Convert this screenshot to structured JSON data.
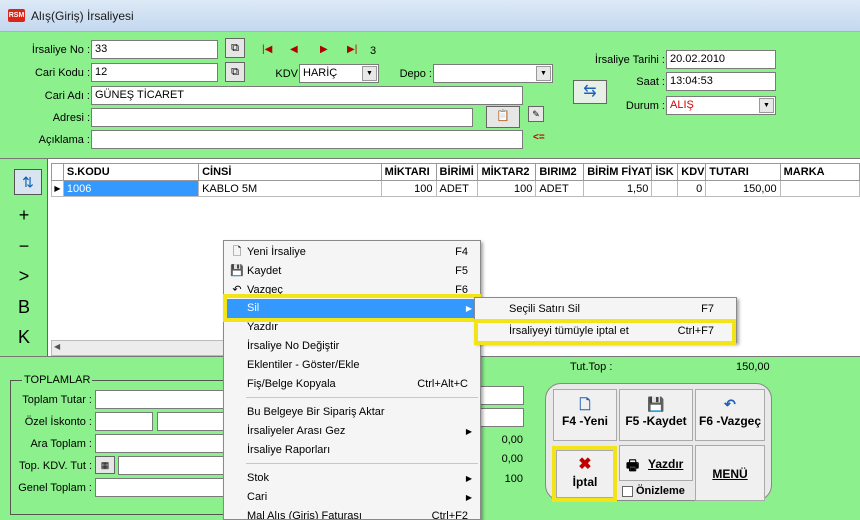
{
  "window": {
    "title": "Alış(Giriş) İrsaliyesi",
    "app_icon": "RSM"
  },
  "header": {
    "irsaliye_no_label": "İrsaliye No :",
    "irsaliye_no_value": "33",
    "cari_kodu_label": "Cari Kodu :",
    "cari_kodu_value": "12",
    "cari_adi_label": "Cari Adı :",
    "cari_adi_value": "GÜNEŞ TİCARET",
    "adresi_label": "Adresi :",
    "adresi_value": "",
    "aciklama_label": "Açıklama :",
    "aciklama_value": "",
    "kdv_label": "KDV",
    "kdv_value": "HARİÇ",
    "depo_label": "Depo :",
    "depo_value": "",
    "record_count": "3",
    "tarih_label": "İrsaliye Tarihi :",
    "tarih_value": "20.02.2010",
    "saat_label": "Saat :",
    "saat_value": "13:04:53",
    "durum_label": "Durum :",
    "durum_value": "ALIŞ",
    "back_arrow": "<="
  },
  "grid": {
    "toolbar": {
      "add": "+",
      "remove": "−",
      "next": ">",
      "b": "B",
      "k": "K"
    },
    "columns": [
      "S.KODU",
      "CİNSİ",
      "MİKTARI",
      "BİRİMİ",
      "MİKTAR2",
      "BIRIM2",
      "BİRİM FİYAT",
      "İSK",
      "KDV",
      "TUTARI",
      "MARKA"
    ],
    "rows": [
      [
        "1006",
        "KABLO 5M",
        "100",
        "ADET",
        "100",
        "ADET",
        "1,50",
        "",
        "0",
        "150,00",
        ""
      ]
    ]
  },
  "totals": {
    "group_title": "TOPLAMLAR",
    "toplam_tutar_label": "Toplam Tutar :",
    "ozel_iskonto_label": "Özel İskonto :",
    "ara_toplam_label": "Ara Toplam :",
    "top_kdv_label": "Top. KDV. Tut :",
    "genel_toplam_label": "Genel Toplam :",
    "tut_top_label": "Tut.Top :",
    "tut_top_value": "150,00",
    "val_1": "0,00",
    "val_2": "0,00",
    "val_3": "100"
  },
  "buttons": {
    "yeni": "F4 -Yeni",
    "kaydet": "F5 -Kaydet",
    "vazgec": "F6 -Vazgeç",
    "iptal": "İptal",
    "yazdir": "Yazdır",
    "menu": "MENÜ",
    "onizleme": "Önizleme"
  },
  "context_menu": {
    "items": [
      {
        "label": "Yeni İrsaliye",
        "shortcut": "F4",
        "icon": "new-doc-icon"
      },
      {
        "label": "Kaydet",
        "shortcut": "F5",
        "icon": "save-icon"
      },
      {
        "label": "Vazgeç",
        "shortcut": "F6",
        "icon": "undo-icon"
      },
      {
        "label": "Sil",
        "shortcut": "",
        "icon": ""
      },
      {
        "label": "Yazdır",
        "shortcut": "",
        "icon": ""
      },
      {
        "label": "İrsaliye No Değiştir",
        "shortcut": "",
        "icon": ""
      },
      {
        "label": "Eklentiler - Göster/Ekle",
        "shortcut": "",
        "icon": ""
      },
      {
        "label": "Fiş/Belge Kopyala",
        "shortcut": "Ctrl+Alt+C",
        "icon": ""
      },
      {
        "label": "Bu Belgeye Bir Sipariş Aktar",
        "shortcut": "",
        "icon": ""
      },
      {
        "label": "İrsaliyeler Arası Gez",
        "shortcut": "",
        "icon": ""
      },
      {
        "label": "İrsaliye Raporları",
        "shortcut": "",
        "icon": ""
      },
      {
        "label": "Stok",
        "shortcut": "",
        "icon": ""
      },
      {
        "label": "Cari",
        "shortcut": "",
        "icon": ""
      },
      {
        "label": "Mal Alış (Giriş) Faturası",
        "shortcut": "Ctrl+F2",
        "icon": ""
      }
    ]
  },
  "submenu": {
    "items": [
      {
        "label": "Seçili Satırı Sil",
        "shortcut": "F7"
      },
      {
        "label": "İrsaliyeyi tümüyle iptal et",
        "shortcut": "Ctrl+F7"
      }
    ]
  },
  "colors": {
    "form_bg": "#8cf08c",
    "highlight": "#f3e41a",
    "selection": "#3399ff"
  }
}
